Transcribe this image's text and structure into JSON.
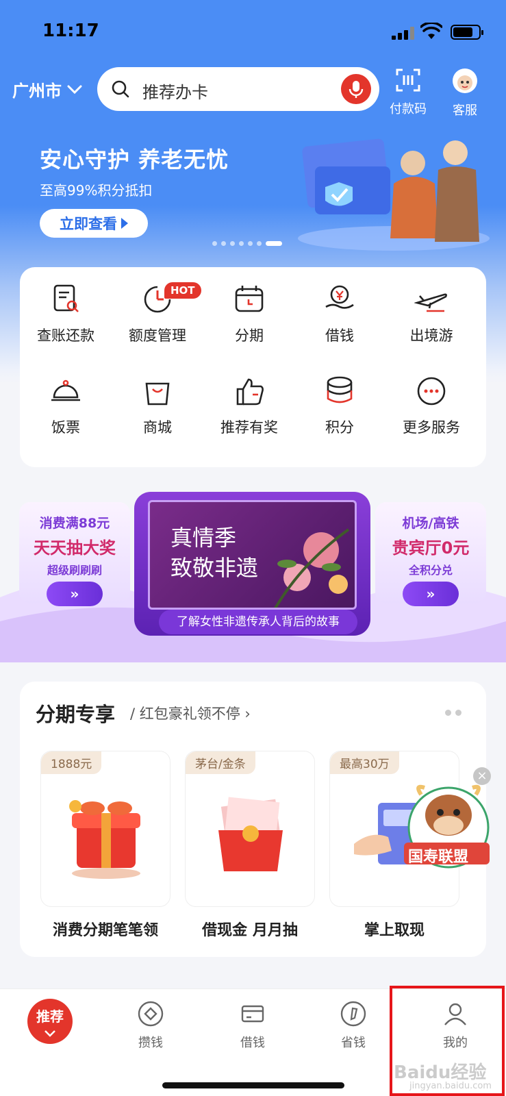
{
  "status_bar": {
    "time": "11:17"
  },
  "header": {
    "city": "广州市",
    "search_placeholder": "推荐办卡",
    "pay_code_label": "付款码",
    "service_label": "客服"
  },
  "banner": {
    "title": "安心守护 养老无忧",
    "subtitle": "至高99%积分抵扣",
    "button_label": "立即查看",
    "page_count": 7,
    "active_page": 7
  },
  "services": [
    {
      "label": "查账还款",
      "icon": "bill-search-icon"
    },
    {
      "label": "额度管理",
      "icon": "quota-icon",
      "badge": "HOT"
    },
    {
      "label": "分期",
      "icon": "calendar-icon"
    },
    {
      "label": "借钱",
      "icon": "money-hand-icon"
    },
    {
      "label": "出境游",
      "icon": "airplane-icon"
    },
    {
      "label": "饭票",
      "icon": "dish-cloche-icon"
    },
    {
      "label": "商城",
      "icon": "shopping-bag-icon"
    },
    {
      "label": "推荐有奖",
      "icon": "thumbs-up-icon"
    },
    {
      "label": "积分",
      "icon": "coin-stack-icon"
    },
    {
      "label": "更多服务",
      "icon": "more-icon"
    }
  ],
  "promo": {
    "left_line1": "消费满88元",
    "left_line2": "天天抽大奖",
    "left_line3": "超级刷刷刷",
    "center_title_line1": "真情季",
    "center_title_line2": "致敬非遗",
    "center_caption": "了解女性非遗传承人背后的故事",
    "right_line1": "机场/高铁",
    "right_line2": "贵宾厅0元",
    "right_line3": "全积分兑",
    "arrow": "»"
  },
  "installments": {
    "title": "分期专享",
    "subtitle": "/ 红包豪礼领不停 ›",
    "products": [
      {
        "tag": "1888元",
        "name": "消费分期笔笔领"
      },
      {
        "tag": "茅台/金条",
        "name": "借现金 月月抽"
      },
      {
        "tag": "最高30万",
        "name": "掌上取现"
      }
    ],
    "mascot_label": "国寿联盟"
  },
  "tabbar": {
    "tabs": [
      {
        "label": "推荐",
        "icon": "recommend-icon",
        "active": true
      },
      {
        "label": "攒钱",
        "icon": "diamond-icon"
      },
      {
        "label": "借钱",
        "icon": "card-icon"
      },
      {
        "label": "省钱",
        "icon": "coupon-icon"
      },
      {
        "label": "我的",
        "icon": "profile-icon"
      }
    ]
  },
  "watermark": {
    "text": "Baidu经验",
    "sub": "jingyan.baidu.com"
  },
  "colors": {
    "primary_blue": "#4b8df5",
    "brand_red": "#e3352b",
    "promo_purple": "#7a37d8"
  }
}
